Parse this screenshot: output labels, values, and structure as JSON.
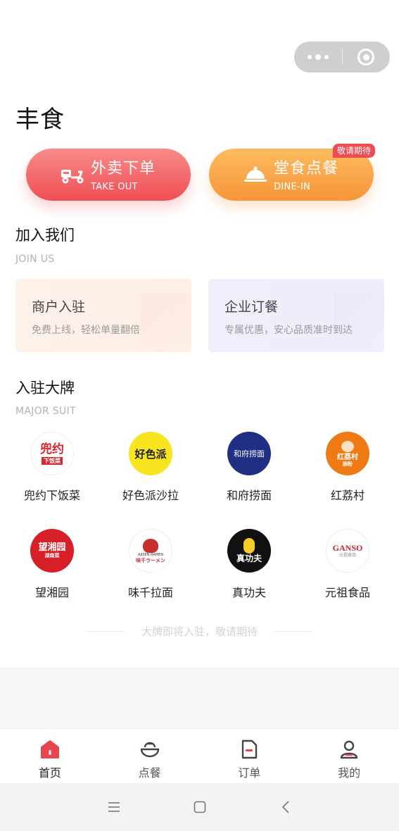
{
  "header": {
    "title": "丰食"
  },
  "order_buttons": {
    "takeout": {
      "label": "外卖下单",
      "sub": "TAKE OUT",
      "icon": "scooter-icon"
    },
    "dinein": {
      "label": "堂食点餐",
      "sub": "DINE-IN",
      "icon": "food-cloche-icon",
      "badge": "敬请期待"
    }
  },
  "join": {
    "title": "加入我们",
    "subtitle": "JOIN US",
    "cards": [
      {
        "title": "商户入驻",
        "desc": "免费上线，轻松单量翻倍"
      },
      {
        "title": "企业订餐",
        "desc": "专属优惠，安心品质准时到达"
      }
    ]
  },
  "brands": {
    "title": "入驻大牌",
    "subtitle": "MAJOR SUIT",
    "items": [
      {
        "name": "兜约下饭菜",
        "logo_text": "兜约",
        "logo_sub": "下饭菜"
      },
      {
        "name": "好色派沙拉",
        "logo_text": "好色派"
      },
      {
        "name": "和府捞面",
        "logo_text": "和府捞面"
      },
      {
        "name": "红荔村",
        "logo_text": "红荔村",
        "logo_sub": "肠粉"
      },
      {
        "name": "望湘园",
        "logo_text": "望湘园",
        "logo_sub": "湖南菜"
      },
      {
        "name": "味千拉面",
        "logo_text": "AJISEN RAMEN",
        "logo_sub": "味千ラーメン"
      },
      {
        "name": "真功夫",
        "logo_text": "真功夫"
      },
      {
        "name": "元祖食品",
        "logo_text": "GANSO",
        "logo_sub": "元祖食品"
      }
    ],
    "footer_note": "大牌即将入驻，敬请期待"
  },
  "tabbar": [
    {
      "label": "首页",
      "icon": "home-icon",
      "active": true
    },
    {
      "label": "点餐",
      "icon": "bowl-icon",
      "active": false
    },
    {
      "label": "订单",
      "icon": "order-document-icon",
      "active": false
    },
    {
      "label": "我的",
      "icon": "user-icon",
      "active": false
    }
  ],
  "colors": {
    "takeout_accent": "#ef4f54",
    "dinein_accent": "#f7953a",
    "badge": "#ee4b53",
    "active_tab_icon": "#e8464f"
  }
}
